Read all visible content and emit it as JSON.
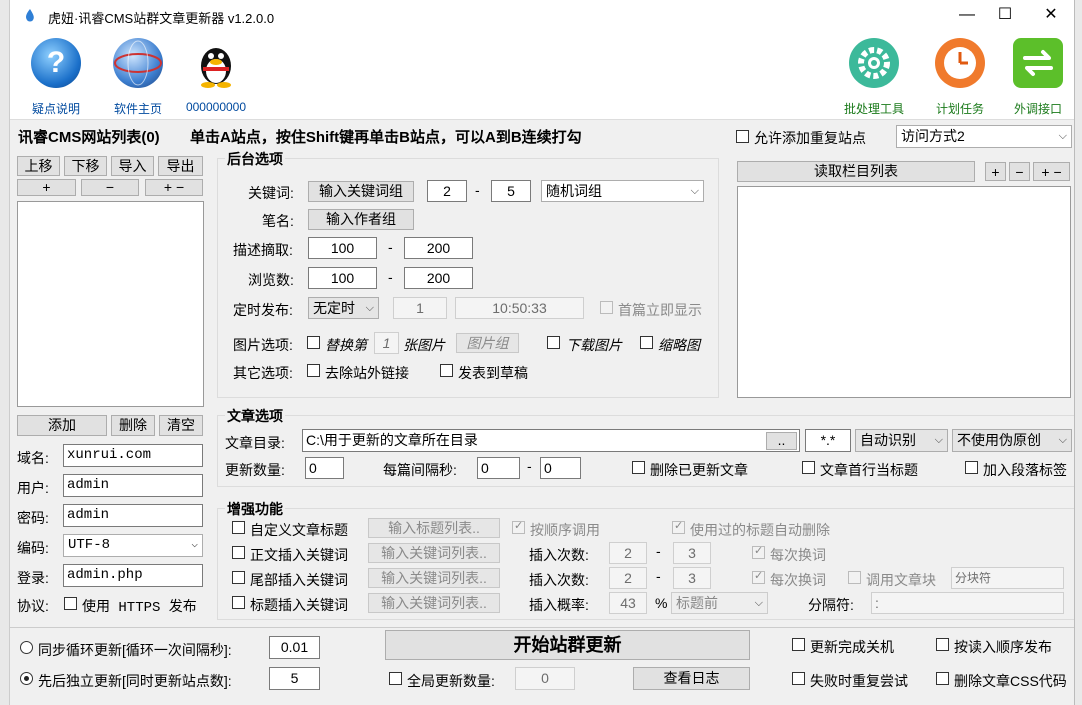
{
  "window": {
    "title": "虎妞·讯睿CMS站群文章更新器 v1.2.0.0",
    "min": "—",
    "max": "☐",
    "close": "✕"
  },
  "toolbar": {
    "left": [
      {
        "label": "疑点说明",
        "icon": "help-icon"
      },
      {
        "label": "软件主页",
        "icon": "globe-icon"
      },
      {
        "label": "000000000",
        "icon": "qq-penguin-icon"
      }
    ],
    "right": [
      {
        "label": "批处理工具",
        "icon": "gear-icon"
      },
      {
        "label": "计划任务",
        "icon": "clock-icon"
      },
      {
        "label": "外调接口",
        "icon": "swap-arrows-icon"
      }
    ]
  },
  "header": {
    "list_title": "讯睿CMS网站列表(0)",
    "hint": "单击A站点，按住Shift键再单击B站点，可以A到B连续打勾",
    "allow_dup": "允许添加重复站点",
    "access_mode": "访问方式2"
  },
  "site_list": {
    "up": "上移",
    "down": "下移",
    "import": "导入",
    "export": "导出",
    "plus": "+",
    "minus": "−",
    "plusminus": "+ −",
    "add": "添加",
    "delete": "删除",
    "clear": "清空"
  },
  "site_form": {
    "domain_label": "域名:",
    "domain": "xunrui.com",
    "user_label": "用户:",
    "user": "admin",
    "pass_label": "密码:",
    "pass": "admin",
    "enc_label": "编码:",
    "enc": "UTF-8",
    "login_label": "登录:",
    "login": "admin.php",
    "proto_label": "协议:",
    "proto": "使用 HTTPS 发布"
  },
  "backend": {
    "title": "后台选项",
    "kw_label": "关键词:",
    "kw_btn": "输入关键词组",
    "kw_min": "2",
    "kw_max": "5",
    "kw_mode": "随机词组",
    "pen_label": "笔名:",
    "pen_btn": "输入作者组",
    "desc_label": "描述摘取:",
    "desc_min": "100",
    "desc_max": "200",
    "views_label": "浏览数:",
    "views_min": "100",
    "views_max": "200",
    "sched_label": "定时发布:",
    "sched_mode": "无定时",
    "sched_n": "1",
    "sched_time": "10:50:33",
    "first_show": "首篇立即显示",
    "img_label": "图片选项:",
    "img_replace": "替换第",
    "img_n": "1",
    "img_unit": "张图片",
    "img_group": "图片组",
    "img_download": "下载图片",
    "img_thumb": "缩略图",
    "other_label": "其它选项:",
    "remove_links": "去除站外链接",
    "post_draft": "发表到草稿"
  },
  "column": {
    "read_btn": "读取栏目列表",
    "b1": "+",
    "b2": "−",
    "b3": "+ −"
  },
  "article": {
    "title": "文章选项",
    "dir_label": "文章目录:",
    "dir": "C:\\用于更新的文章所在目录",
    "browse": "..",
    "ext": "*.*",
    "detect": "自动识别",
    "pseudo": "不使用伪原创",
    "count_label": "更新数量:",
    "count": "0",
    "interval_label": "每篇间隔秒:",
    "int_min": "0",
    "int_max": "0",
    "del_updated": "删除已更新文章",
    "first_line_title": "文章首行当标题",
    "add_p": "加入段落标签"
  },
  "enhance": {
    "title": "增强功能",
    "custom_title": "自定义文章标题",
    "title_list": "输入标题列表..",
    "seq_call": "按顺序调用",
    "auto_del": "使用过的标题自动删除",
    "body_kw": "正文插入关键词",
    "kw_list1": "输入关键词列表..",
    "ins_times1": "插入次数:",
    "t1a": "2",
    "t1b": "3",
    "each1": "每次换词",
    "tail_kw": "尾部插入关键词",
    "kw_list2": "输入关键词列表..",
    "ins_times2": "插入次数:",
    "t2a": "2",
    "t2b": "3",
    "each2": "每次换词",
    "call_block": "调用文章块",
    "block_ph": "分块符",
    "title_kw": "标题插入关键词",
    "kw_list3": "输入关键词列表..",
    "prob_label": "插入概率:",
    "prob": "43",
    "pct": "%",
    "pos": "标题前",
    "sep_label": "分隔符:",
    "sep": ":"
  },
  "bottom": {
    "sync_label": "同步循环更新[循环一次间隔秒]:",
    "sync_val": "0.01",
    "seq_label": "先后独立更新[同时更新站点数]:",
    "seq_val": "5",
    "start": "开始站群更新",
    "global_count": "全局更新数量:",
    "global_val": "0",
    "log": "查看日志",
    "shutdown": "更新完成关机",
    "retry": "失败时重复尝试",
    "read_order": "按读入顺序发布",
    "del_css": "删除文章CSS代码"
  },
  "colors": {
    "accent": "#004a9f",
    "green": "#1a7a1a"
  }
}
